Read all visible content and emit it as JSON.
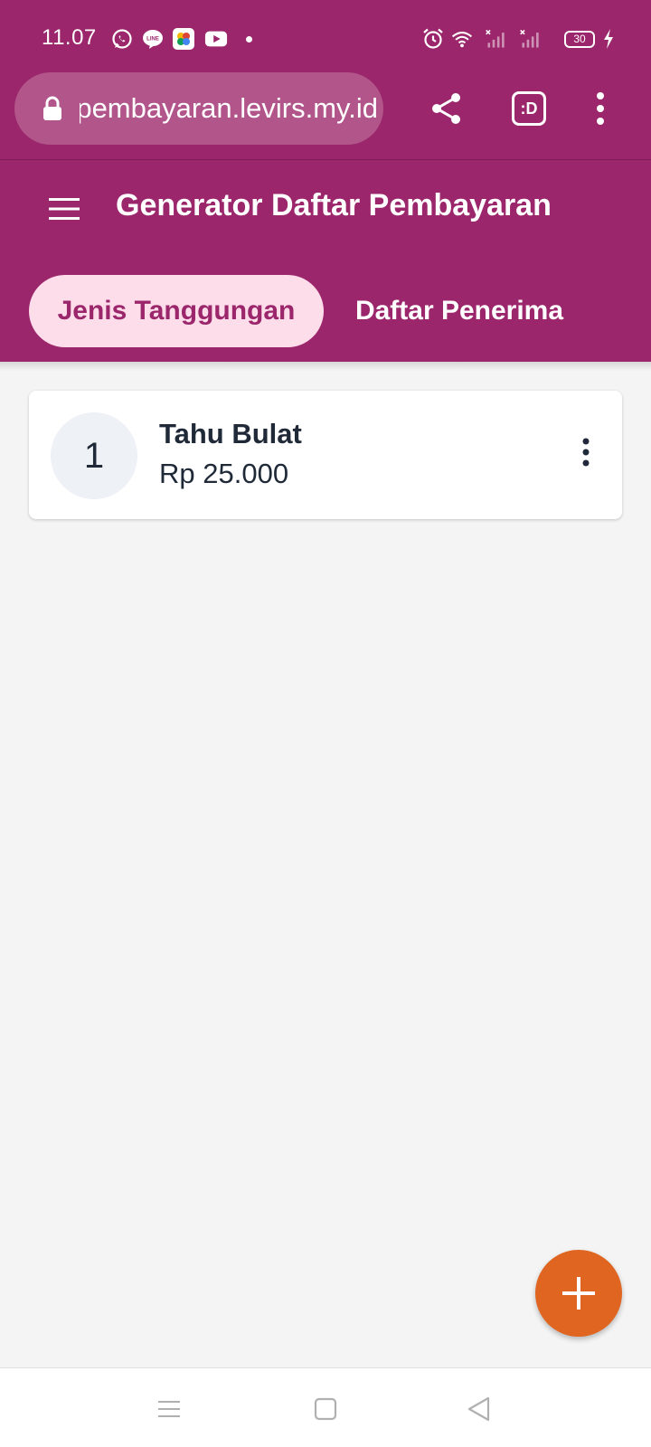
{
  "status_bar": {
    "time": "11.07",
    "battery": "30",
    "notification_icons": [
      "whatsapp-icon",
      "line-icon",
      "photos-icon",
      "youtube-icon"
    ],
    "system_icons": [
      "alarm-icon",
      "wifi-icon",
      "signal-icon",
      "signal-icon",
      "charging-icon"
    ]
  },
  "browser": {
    "url": "pembayaran.levirs.my.id",
    "tab_count_label": ":D"
  },
  "app": {
    "title": "Generator Daftar Pembayaran",
    "tabs": [
      {
        "label": "Jenis Tanggungan",
        "active": true
      },
      {
        "label": "Daftar Penerima",
        "active": false
      }
    ]
  },
  "items": [
    {
      "number": "1",
      "name": "Tahu Bulat",
      "price": "Rp 25.000"
    }
  ],
  "colors": {
    "primary": "#9b266b",
    "tab_active_bg": "#fddde9",
    "fab": "#e06520",
    "background": "#f4f4f4"
  }
}
